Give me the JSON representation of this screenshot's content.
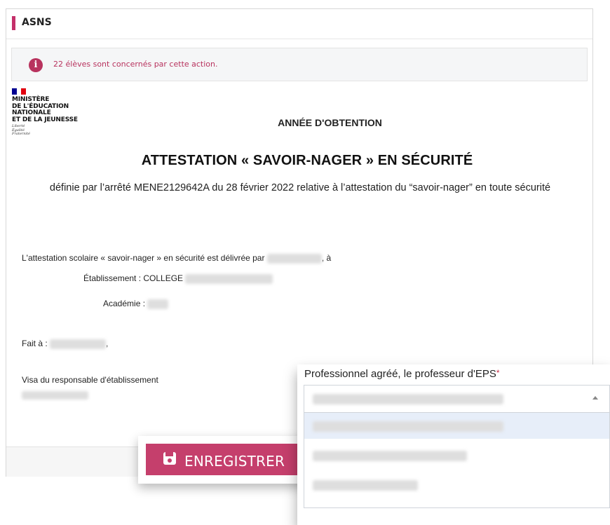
{
  "panel": {
    "title": "ASNS"
  },
  "alert": {
    "icon": "info-icon",
    "text": "22 élèves sont concernés par cette action."
  },
  "logo": {
    "lines": [
      "MINISTÈRE",
      "DE L'ÉDUCATION",
      "NATIONALE",
      "ET DE LA JEUNESSE"
    ],
    "motto": [
      "Liberté",
      "Égalité",
      "Fraternité"
    ],
    "flag_colors": [
      "#000091",
      "#ffffff",
      "#e1000f"
    ]
  },
  "document": {
    "year_title": "ANNÉE D'OBTENTION",
    "title": "ATTESTATION « SAVOIR-NAGER » EN SÉCURITÉ",
    "subtitle": "définie par l’arrêté MENE2129642A du 28 février 2022 relative à l’attestation du “savoir-nager” en toute sécurité",
    "delivered_by_prefix": "L'attestation scolaire « savoir-nager » en sécurité est délivrée par",
    "delivered_by_suffix": ", à",
    "etablissement_label": "Établissement : COLLEGE",
    "academie_label": "Académie :",
    "fait_a_label": "Fait à :",
    "fait_a_suffix": ",",
    "visa_label": "Visa du responsable d'établissement"
  },
  "save_button": {
    "label": "ENREGISTRER",
    "icon": "save-icon"
  },
  "dropdown": {
    "label": "Professionnel agréé, le professeur d'EPS",
    "required_mark": "*"
  },
  "colors": {
    "accent": "#c4306a",
    "alert_text": "#b8335e",
    "button": "#c53f6c"
  }
}
